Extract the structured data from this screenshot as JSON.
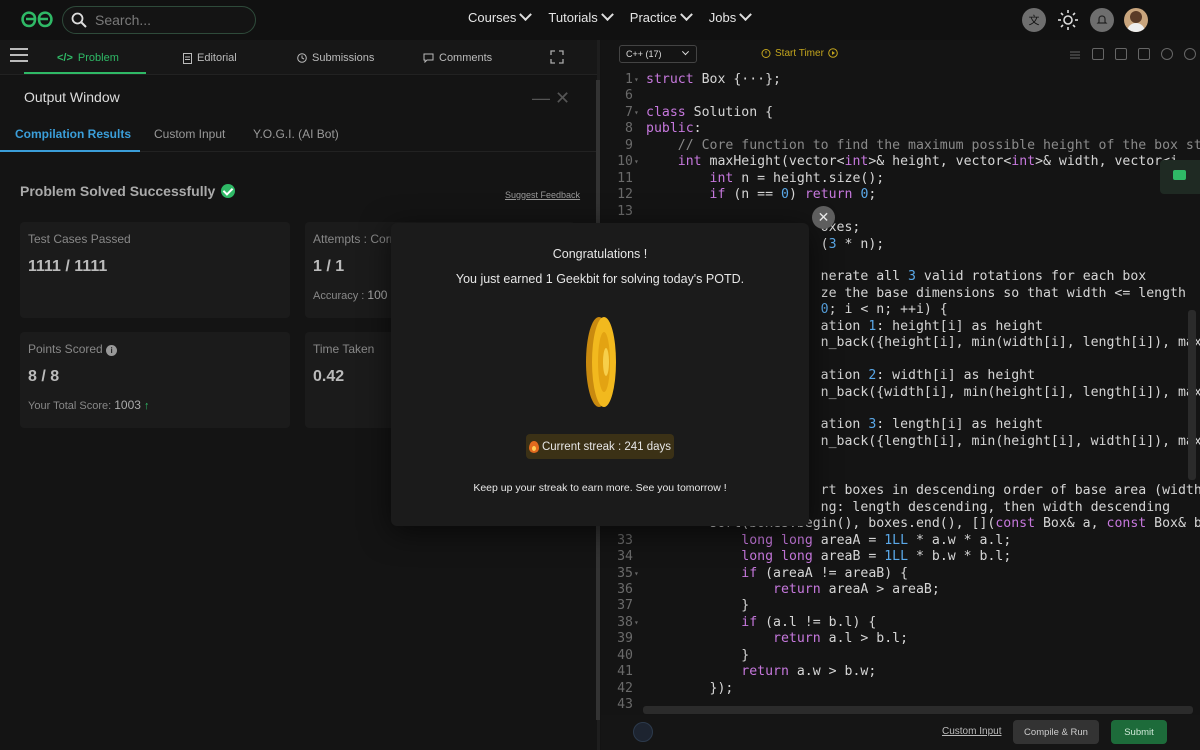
{
  "nav": {
    "search_placeholder": "Search...",
    "menu": [
      "Courses",
      "Tutorials",
      "Practice",
      "Jobs"
    ]
  },
  "left_tabs": {
    "problem": "Problem",
    "editorial": "Editorial",
    "submissions": "Submissions",
    "comments": "Comments"
  },
  "output": {
    "title": "Output Window",
    "tabs": [
      "Compilation Results",
      "Custom Input",
      "Y.O.G.I. (AI Bot)"
    ],
    "status": "Problem Solved Successfully",
    "feedback_link": "Suggest Feedback",
    "cards": {
      "test_cases": {
        "label": "Test Cases Passed",
        "value": "1111 / 1111"
      },
      "attempts": {
        "label": "Attempts : Corr",
        "value": "1 / 1",
        "sub_label": "Accuracy :",
        "sub_value": "100"
      },
      "points": {
        "label": "Points Scored",
        "value": "8 / 8",
        "sub_label": "Your Total Score:",
        "sub_value": "1003"
      },
      "time": {
        "label": "Time Taken",
        "value": "0.42"
      }
    }
  },
  "editor": {
    "language": "C++ (17)",
    "timer_label": "Start Timer",
    "code_lines": [
      {
        "n": "1",
        "fold": true,
        "text": "struct Box {···};"
      },
      {
        "n": "6",
        "fold": false,
        "text": ""
      },
      {
        "n": "7",
        "fold": true,
        "text": "class Solution {"
      },
      {
        "n": "8",
        "fold": false,
        "text": "public:"
      },
      {
        "n": "9",
        "fold": false,
        "text": "    // Core function to find the maximum possible height of the box sta"
      },
      {
        "n": "10",
        "fold": true,
        "text": "    int maxHeight(vector<int>& height, vector<int>& width, vector<i"
      },
      {
        "n": "11",
        "fold": false,
        "text": "        int n = height.size();"
      },
      {
        "n": "12",
        "fold": false,
        "text": "        if (n == 0) return 0;"
      },
      {
        "n": "13",
        "fold": false,
        "text": ""
      },
      {
        "n": "",
        "fold": false,
        "text": "                      oxes;"
      },
      {
        "n": "",
        "fold": false,
        "text": "                      (3 * n);"
      },
      {
        "n": "",
        "fold": false,
        "text": ""
      },
      {
        "n": "",
        "fold": false,
        "text": "                      nerate all 3 valid rotations for each box"
      },
      {
        "n": "",
        "fold": false,
        "text": "                      ze the base dimensions so that width <= length"
      },
      {
        "n": "",
        "fold": false,
        "text": "                      0; i < n; ++i) {"
      },
      {
        "n": "",
        "fold": false,
        "text": "                      ation 1: height[i] as height"
      },
      {
        "n": "",
        "fold": false,
        "text": "                      n_back({height[i], min(width[i], length[i]), max(w"
      },
      {
        "n": "",
        "fold": false,
        "text": ""
      },
      {
        "n": "",
        "fold": false,
        "text": "                      ation 2: width[i] as height"
      },
      {
        "n": "",
        "fold": false,
        "text": "                      n_back({width[i], min(height[i], length[i]), max(h"
      },
      {
        "n": "",
        "fold": false,
        "text": ""
      },
      {
        "n": "",
        "fold": false,
        "text": "                      ation 3: length[i] as height"
      },
      {
        "n": "",
        "fold": false,
        "text": "                      n_back({length[i], min(height[i], width[i]), max(h"
      },
      {
        "n": "",
        "fold": false,
        "text": ""
      },
      {
        "n": "",
        "fold": false,
        "text": ""
      },
      {
        "n": "",
        "fold": false,
        "text": "                      rt boxes in descending order of base area (width *"
      },
      {
        "n": "",
        "fold": false,
        "text": "                      ng: length descending, then width descending"
      },
      {
        "n": "33",
        "fold": false,
        "text": "            long long areaA = 1LL * a.w * a.l;"
      },
      {
        "n": "34",
        "fold": false,
        "text": "            long long areaB = 1LL * b.w * b.l;"
      },
      {
        "n": "35",
        "fold": true,
        "text": "            if (areaA != areaB) {"
      },
      {
        "n": "36",
        "fold": false,
        "text": "                return areaA > areaB;"
      },
      {
        "n": "37",
        "fold": false,
        "text": "            }"
      },
      {
        "n": "38",
        "fold": true,
        "text": "            if (a.l != b.l) {"
      },
      {
        "n": "39",
        "fold": false,
        "text": "                return a.l > b.l;"
      },
      {
        "n": "40",
        "fold": false,
        "text": "            }"
      },
      {
        "n": "41",
        "fold": false,
        "text": "            return a.w > b.w;"
      },
      {
        "n": "42",
        "fold": false,
        "text": "        });"
      },
      {
        "n": "43",
        "fold": false,
        "text": ""
      }
    ],
    "line32_text": "        sort(boxes.begin(), boxes.end(), [](const Box& a, const Box& b)",
    "custom_input": "Custom Input",
    "compile_run": "Compile & Run",
    "submit": "Submit"
  },
  "modal": {
    "title": "Congratulations !",
    "message": "You just earned 1 Geekbit for solving today's POTD.",
    "streak": "Current streak : 241 days",
    "footer": "Keep up your streak to earn more. See you tomorrow !"
  },
  "colors": {
    "brand_green": "#2fb966",
    "link_blue": "#3b9ed9",
    "coin_gold": "#f2b91e"
  }
}
